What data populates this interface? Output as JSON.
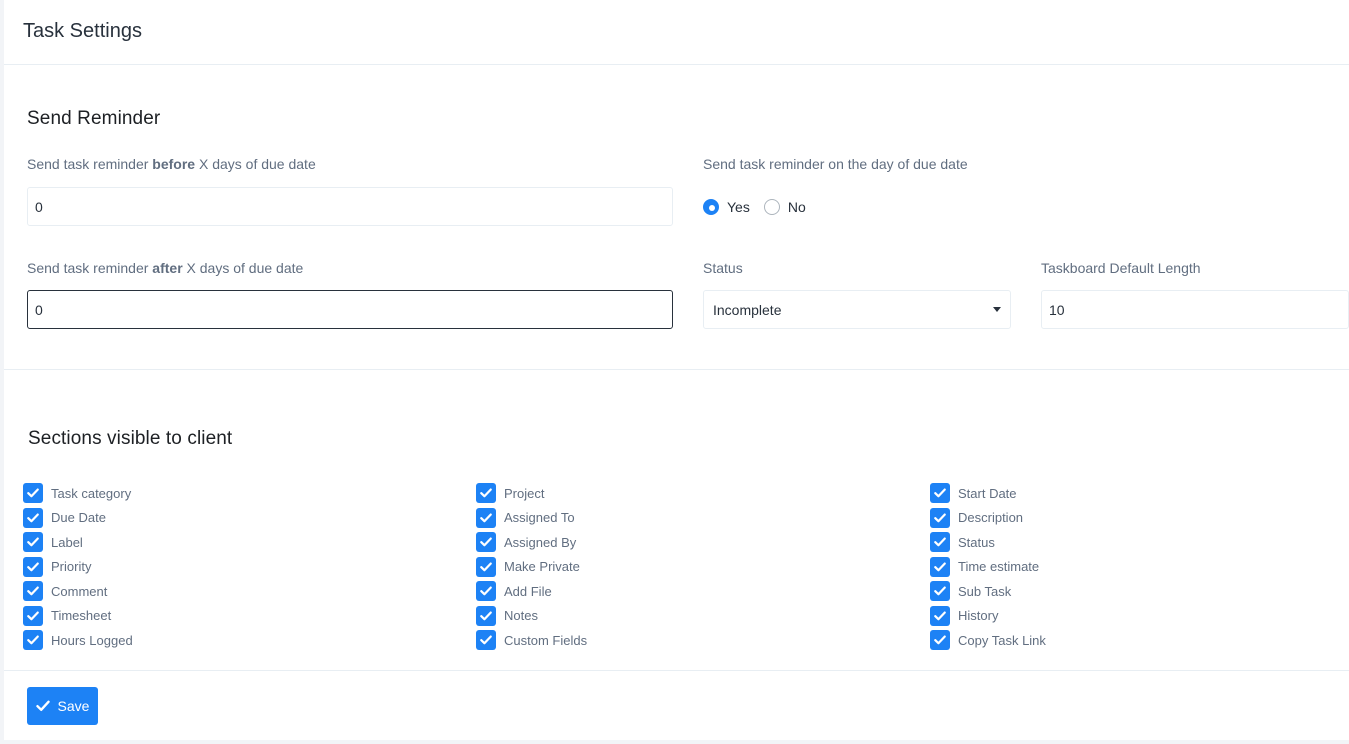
{
  "page": {
    "title": "Task Settings"
  },
  "reminder": {
    "heading": "Send Reminder",
    "before_label_pre": "Send task reminder ",
    "before_label_bold": "before",
    "before_label_post": " X days of due date",
    "before_value": "0",
    "after_label_pre": "Send task reminder ",
    "after_label_bold": "after",
    "after_label_post": " X days of due date",
    "after_value": "0",
    "on_day_label": "Send task reminder on the day of due date",
    "on_day_options": [
      {
        "label": "Yes",
        "checked": true
      },
      {
        "label": "No",
        "checked": false
      }
    ],
    "status_label": "Status",
    "status_value": "Incomplete",
    "taskboard_label": "Taskboard Default Length",
    "taskboard_value": "10"
  },
  "client_sections": {
    "heading": "Sections visible to client",
    "columns": [
      [
        "Task category",
        "Due Date",
        "Label",
        "Priority",
        "Comment",
        "Timesheet",
        "Hours Logged"
      ],
      [
        "Project",
        "Assigned To",
        "Assigned By",
        "Make Private",
        "Add File",
        "Notes",
        "Custom Fields"
      ],
      [
        "Start Date",
        "Description",
        "Status",
        "Time estimate",
        "Sub Task",
        "History",
        "Copy Task Link"
      ]
    ],
    "all_checked": true
  },
  "actions": {
    "save_label": "Save"
  },
  "colors": {
    "accent": "#1d82f5",
    "text": "#28313c",
    "muted": "#616e80"
  }
}
